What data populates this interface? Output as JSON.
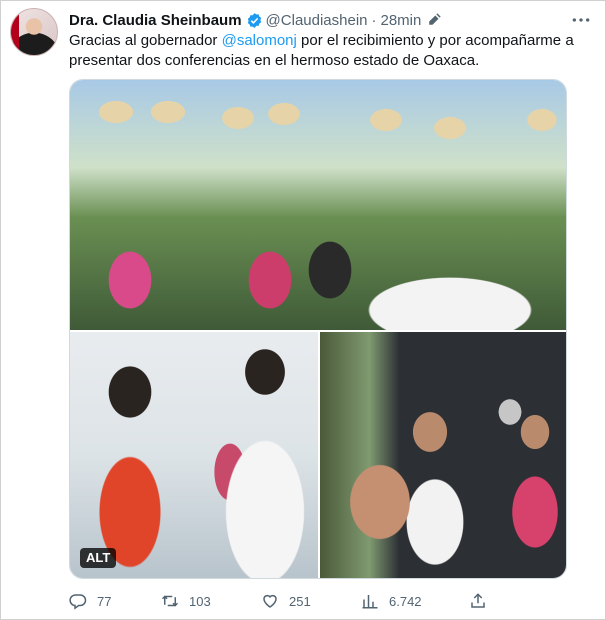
{
  "author": {
    "name": "Dra. Claudia Sheinbaum",
    "handle": "@Claudiashein",
    "separator": "·",
    "time": "28min"
  },
  "tweet": {
    "text_before": "Gracias al gobernador ",
    "mention": "@salomonj",
    "text_after": " por el recibimiento y por acompañarme a presentar dos conferencias en el hermoso estado de Oaxaca."
  },
  "media": {
    "alt_badge": "ALT"
  },
  "actions": {
    "replies": "77",
    "retweets": "103",
    "likes": "251",
    "views": "6.742"
  },
  "icons": [
    "verified-badge-icon",
    "edit-pencil-icon",
    "more-icon",
    "reply-icon",
    "retweet-icon",
    "like-icon",
    "views-icon",
    "share-icon"
  ],
  "colors": {
    "accent": "#1d9bf0",
    "secondary_text": "#536471",
    "text": "#0f1419"
  }
}
